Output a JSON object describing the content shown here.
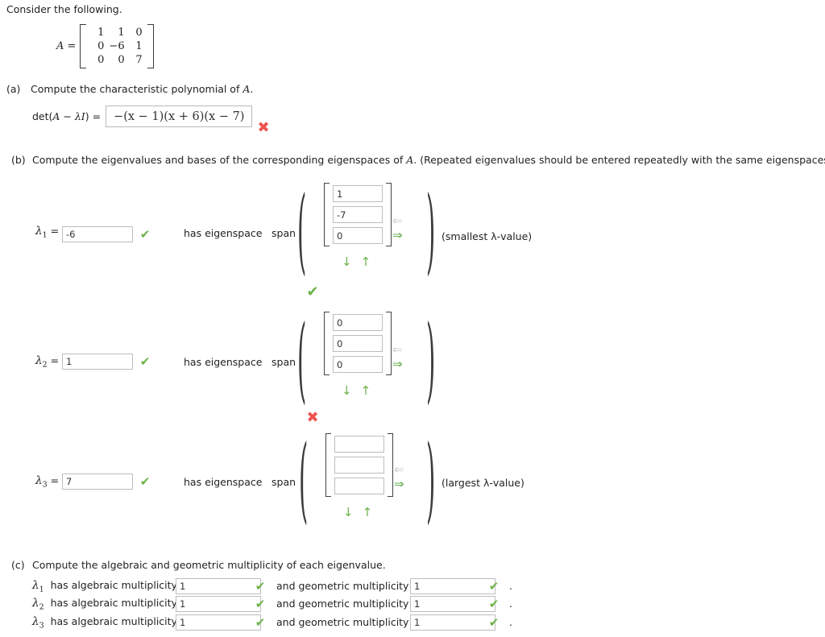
{
  "intro": {
    "text": "Consider the following."
  },
  "matrix": {
    "label": "A =",
    "rows": [
      [
        "1",
        "1",
        "0"
      ],
      [
        "0",
        "−6",
        "1"
      ],
      [
        "0",
        "0",
        "7"
      ]
    ]
  },
  "part_a": {
    "marker": "(a)",
    "prompt": "Compute the characteristic polynomial of A.",
    "det_label": "det(A − λI) =",
    "answer_value": "−(x − 1)(x + 6)(x − 7)",
    "status": "incorrect",
    "status_glyph": "✖"
  },
  "part_b": {
    "marker": "(b)",
    "prompt": "Compute the eigenvalues and bases of the corresponding eigenspaces of A. (Repeated eigenvalues should be entered repeatedly with the same eigenspaces.)",
    "has_eigenspace_label": "has eigenspace",
    "span_label": "span",
    "eq_sign": "=",
    "arrow_left": "⇐",
    "arrow_right": "⇒",
    "arrow_down": "↓",
    "arrow_up": "↑",
    "paren_open": "(",
    "paren_close": ")",
    "blocks": [
      {
        "lambda_label": "λ",
        "lambda_sub": "1",
        "lambda_value": "-6",
        "lambda_status": "correct",
        "lambda_status_glyph": "✔",
        "vector": [
          "1",
          "-7",
          "0"
        ],
        "vector_status": "correct",
        "vector_status_glyph": "✔",
        "note": "(smallest λ-value)"
      },
      {
        "lambda_label": "λ",
        "lambda_sub": "2",
        "lambda_value": "1",
        "lambda_status": "correct",
        "lambda_status_glyph": "✔",
        "vector": [
          "0",
          "0",
          "0"
        ],
        "vector_status": "incorrect",
        "vector_status_glyph": "✖",
        "note": ""
      },
      {
        "lambda_label": "λ",
        "lambda_sub": "3",
        "lambda_value": "7",
        "lambda_status": "correct",
        "lambda_status_glyph": "✔",
        "vector": [
          "",
          "",
          ""
        ],
        "vector_status": "none",
        "vector_status_glyph": "",
        "note": "(largest λ-value)"
      }
    ]
  },
  "part_c": {
    "marker": "(c)",
    "prompt": "Compute the algebraic and geometric multiplicity of each eigenvalue.",
    "algebraic_label": "has algebraic multiplicity",
    "geometric_label": "and geometric multiplicity",
    "period": ".",
    "rows": [
      {
        "lambda_label": "λ",
        "lambda_sub": "1",
        "algebraic_value": "1",
        "algebraic_status_glyph": "✔",
        "geometric_value": "1",
        "geometric_status_glyph": "✔"
      },
      {
        "lambda_label": "λ",
        "lambda_sub": "2",
        "algebraic_value": "1",
        "algebraic_status_glyph": "✔",
        "geometric_value": "1",
        "geometric_status_glyph": "✔"
      },
      {
        "lambda_label": "λ",
        "lambda_sub": "3",
        "algebraic_value": "1",
        "algebraic_status_glyph": "✔",
        "geometric_value": "1",
        "geometric_status_glyph": "✔"
      }
    ]
  },
  "colors": {
    "correct_green": "#6cb34a",
    "incorrect_red": "#ef5350",
    "input_border": "#bdbdbd",
    "text": "#222222",
    "arrow_disabled": "#cccccc",
    "arrow_active": "#5aa843"
  }
}
